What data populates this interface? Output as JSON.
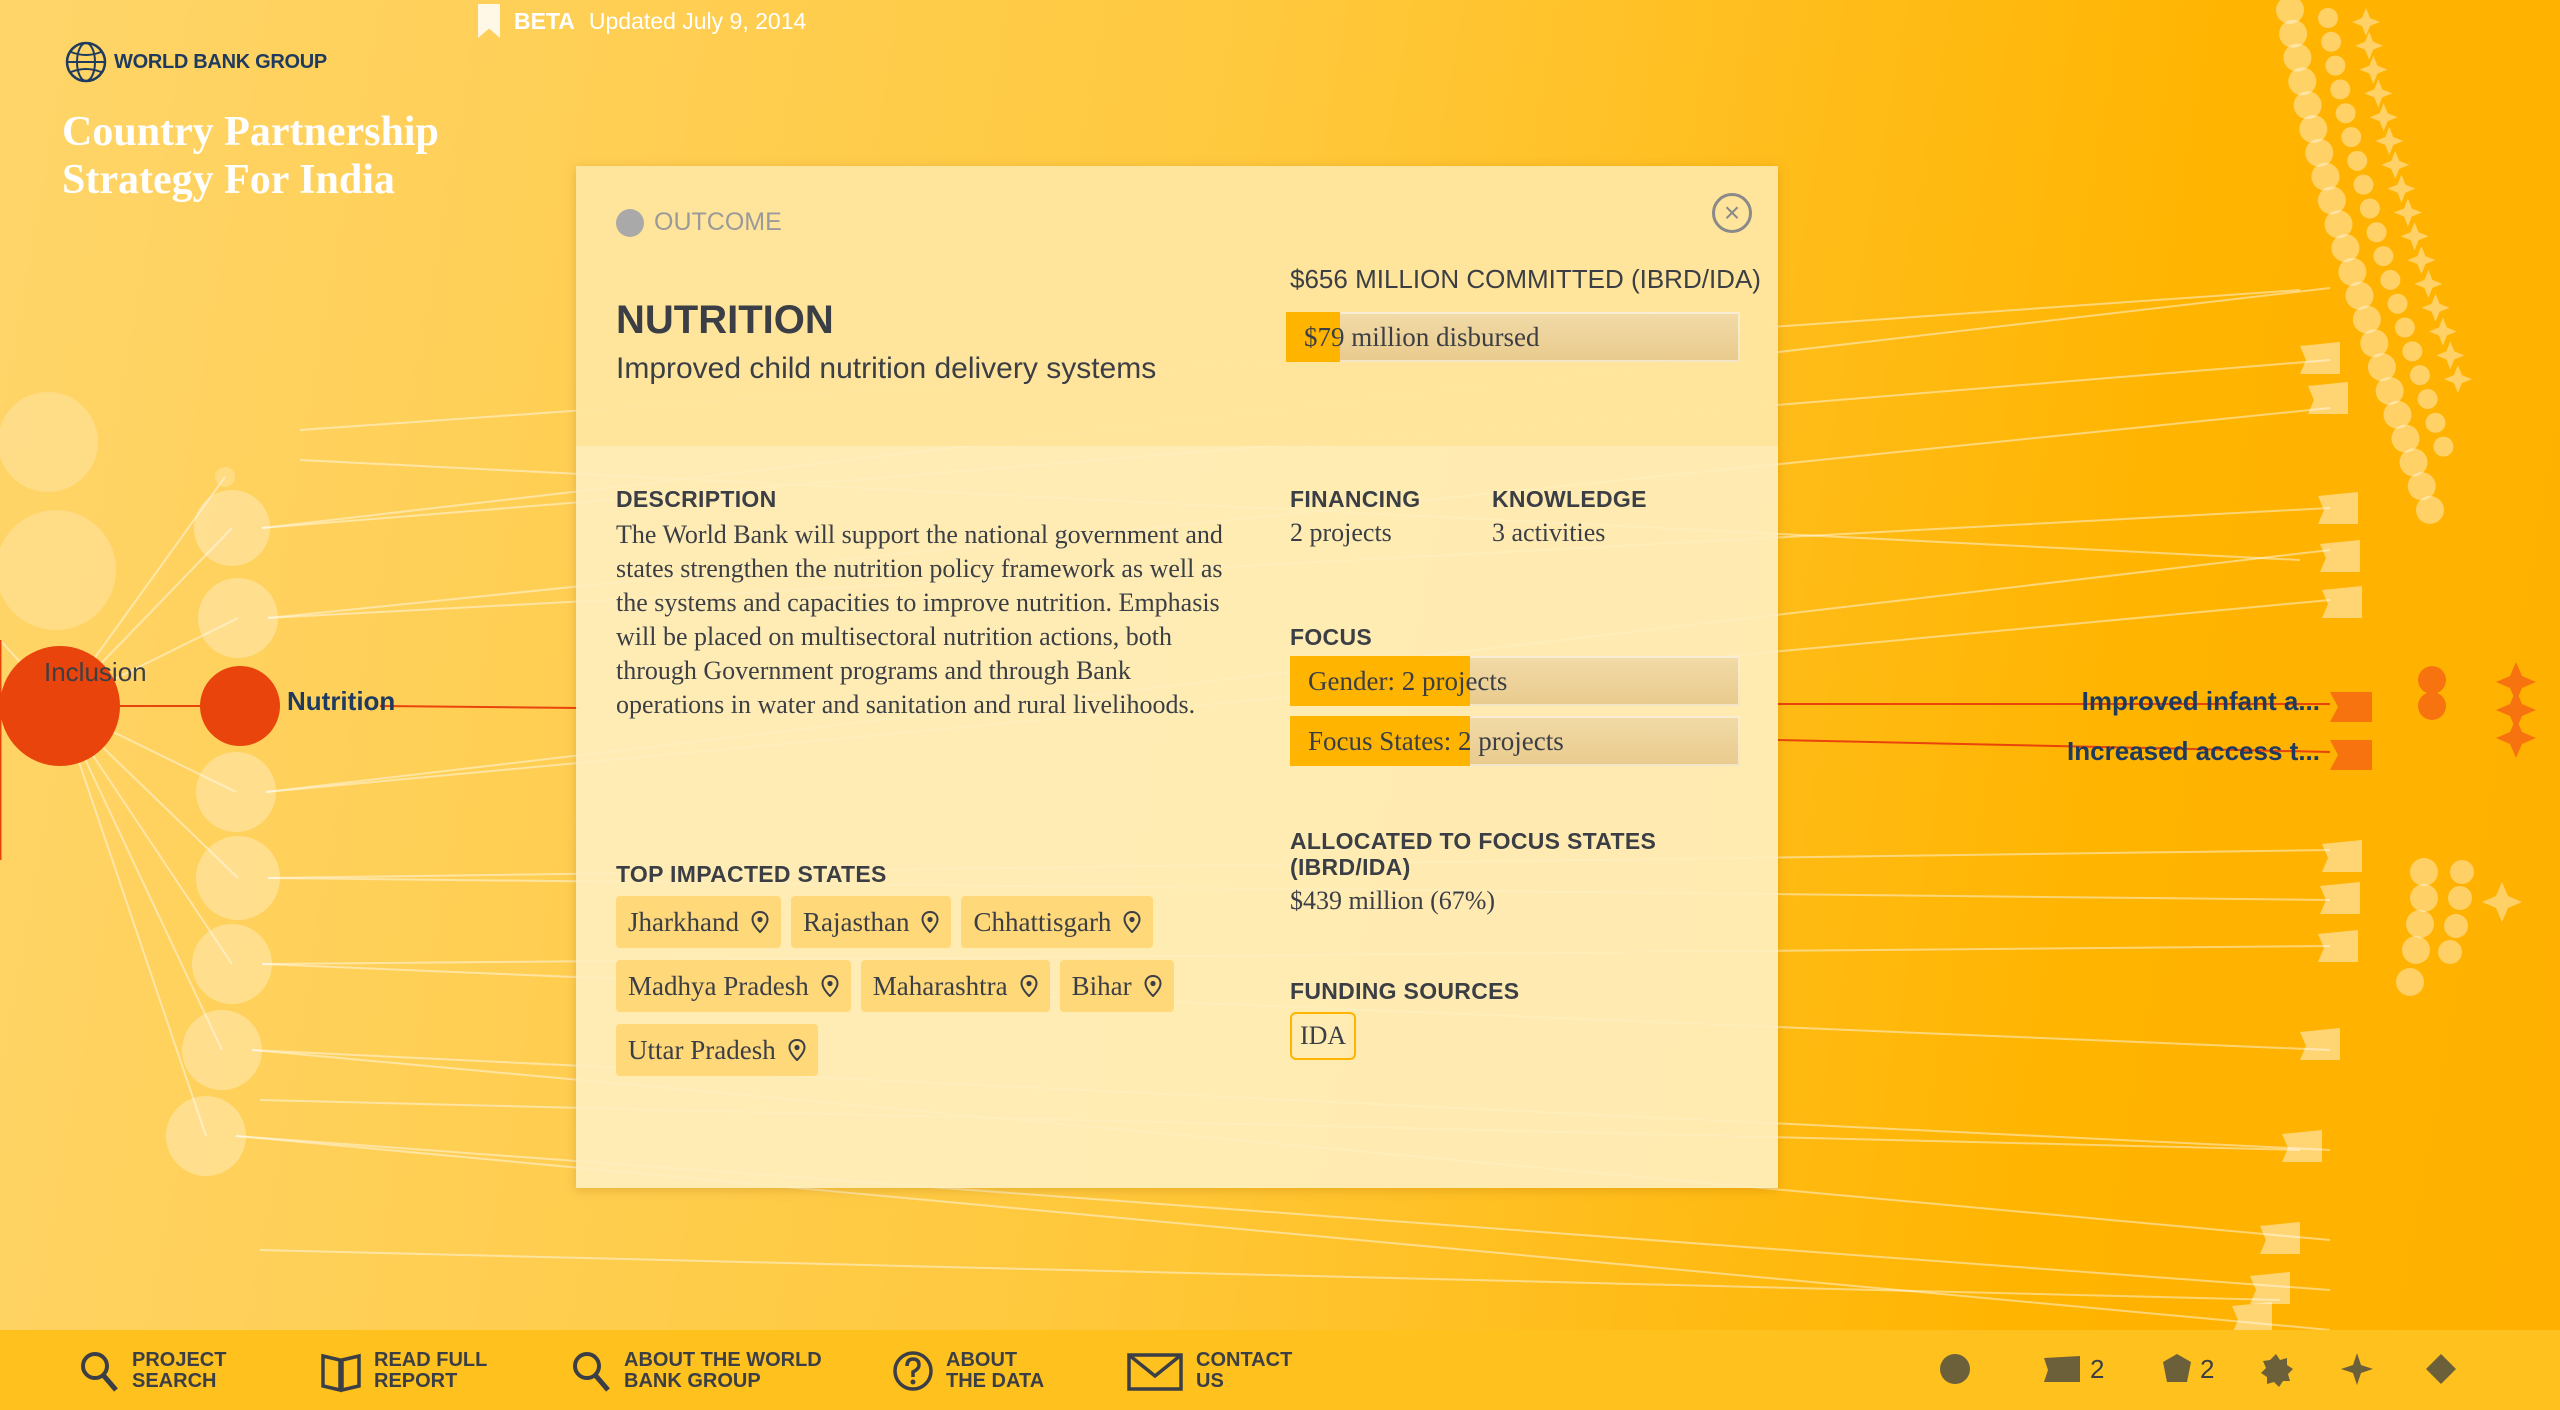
{
  "header": {
    "beta": "BETA",
    "updated": "Updated July 9, 2014",
    "logo_text": "WORLD BANK GROUP",
    "app_title": "Country Partnership Strategy For India"
  },
  "nodes": {
    "inclusion": "Inclusion",
    "nutrition": "Nutrition",
    "outcomes": [
      "Improved infant a...",
      "Increased access t..."
    ]
  },
  "modal": {
    "type_label": "OUTCOME",
    "close": "×",
    "title": "NUTRITION",
    "subtitle": "Improved child nutrition delivery systems",
    "committed": "$656 MILLION COMMITTED (IBRD/IDA)",
    "disbursed": {
      "text": "$79 million disbursed",
      "fraction": 0.12
    },
    "description_heading": "DESCRIPTION",
    "description": "The World Bank will support the national government and states strengthen the nutrition policy framework as well as the systems and capacities to improve nutrition. Emphasis will be placed on multisectoral nutrition actions, both through Government programs and through Bank operations in water and sanitation and rural livelihoods.",
    "financing": {
      "heading": "FINANCING",
      "value": "2 projects"
    },
    "knowledge": {
      "heading": "KNOWLEDGE",
      "value": "3 activities"
    },
    "focus": {
      "heading": "FOCUS",
      "bars": [
        {
          "text": "Gender: 2 projects",
          "fraction": 0.4
        },
        {
          "text": "Focus States: 2 projects",
          "fraction": 0.4
        }
      ]
    },
    "allocated": {
      "heading": "ALLOCATED TO FOCUS STATES (IBRD/IDA)",
      "value": "$439 million (67%)"
    },
    "funding": {
      "heading": "FUNDING SOURCES",
      "source": "IDA"
    },
    "states_heading": "TOP IMPACTED STATES",
    "states": [
      "Jharkhand",
      "Rajasthan",
      "Chhattisgarh",
      "Madhya Pradesh",
      "Maharashtra",
      "Bihar",
      "Uttar Pradesh"
    ]
  },
  "footer": {
    "items": [
      {
        "label1": "PROJECT",
        "label2": "SEARCH",
        "icon": "search-icon"
      },
      {
        "label1": "READ FULL",
        "label2": "REPORT",
        "icon": "book-icon"
      },
      {
        "label1": "ABOUT THE WORLD",
        "label2": "BANK GROUP",
        "icon": "search-icon"
      },
      {
        "label1": "ABOUT",
        "label2": "THE DATA",
        "icon": "question-icon"
      },
      {
        "label1": "CONTACT",
        "label2": "US",
        "icon": "envelope-icon"
      }
    ],
    "legend_counts": {
      "banner": "2",
      "shield": "2"
    }
  },
  "colors": {
    "accent": "#ffb400",
    "node": "#e8440c",
    "text": "#3b3f45",
    "navy": "#1e3a5f"
  }
}
